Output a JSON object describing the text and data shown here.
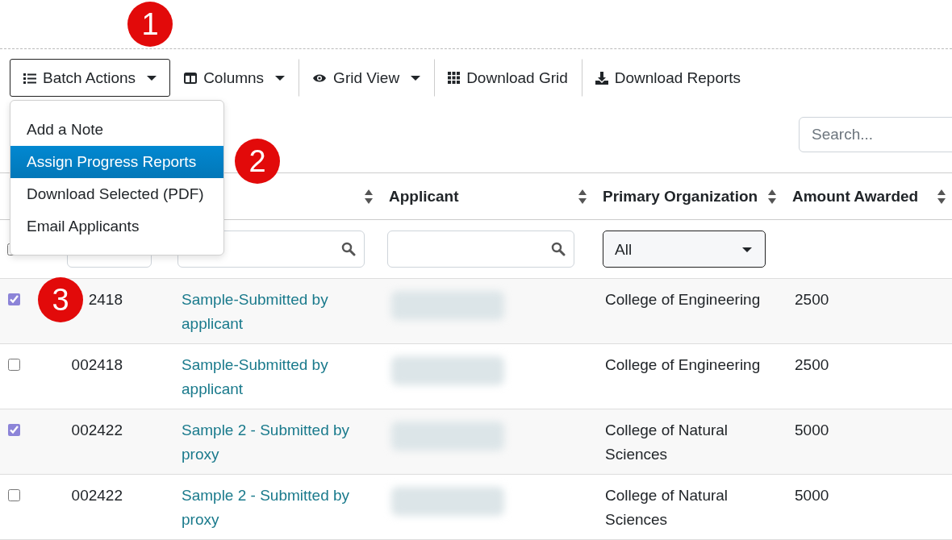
{
  "callouts": [
    {
      "label": "1"
    },
    {
      "label": "2"
    },
    {
      "label": "3"
    }
  ],
  "toolbar": {
    "buttons": [
      {
        "label": "Batch Actions",
        "kind": "dropdown",
        "open": true
      },
      {
        "label": "Columns",
        "kind": "dropdown",
        "open": false
      },
      {
        "label": "Grid View",
        "kind": "dropdown",
        "open": false
      },
      {
        "label": "Download Grid",
        "kind": "action",
        "open": false
      },
      {
        "label": "Download Reports",
        "kind": "action",
        "open": false
      }
    ]
  },
  "batch_menu": {
    "items": [
      {
        "label": "Add a Note",
        "selected": false
      },
      {
        "label": "Assign Progress Reports",
        "selected": true
      },
      {
        "label": "Download Selected (PDF)",
        "selected": false
      },
      {
        "label": "Email Applicants",
        "selected": false
      }
    ]
  },
  "search": {
    "placeholder": "Search..."
  },
  "table": {
    "columns": [
      {
        "kind": "covered"
      },
      {
        "kind": "covered"
      },
      {
        "kind": "header",
        "sortable": true
      },
      {
        "kind": "header",
        "label": "Applicant",
        "sortable": true
      },
      {
        "kind": "header",
        "label": "Primary Organization",
        "sortable": true
      },
      {
        "kind": "header",
        "label": "Amount Awarded",
        "sortable": true
      }
    ],
    "filters": [
      {
        "kind": "checkbox",
        "checked": false
      },
      {
        "kind": "text"
      },
      {
        "kind": "search"
      },
      {
        "kind": "search"
      },
      {
        "kind": "select",
        "value": "All"
      },
      {
        "kind": "none"
      }
    ],
    "rows": [
      {
        "checked": true,
        "id": "2418",
        "title": "Sample-Submitted by applicant",
        "organization": "College of Engineering",
        "amount": "2500"
      },
      {
        "checked": false,
        "id": "002418",
        "title": "Sample-Submitted by applicant",
        "organization": "College of Engineering",
        "amount": "2500"
      },
      {
        "checked": true,
        "id": "002422",
        "title": "Sample 2 - Submitted by proxy",
        "organization": "College of Natural Sciences",
        "amount": "5000"
      },
      {
        "checked": false,
        "id": "002422",
        "title": "Sample 2 - Submitted by proxy",
        "organization": "College of Natural Sciences",
        "amount": "5000"
      }
    ]
  }
}
